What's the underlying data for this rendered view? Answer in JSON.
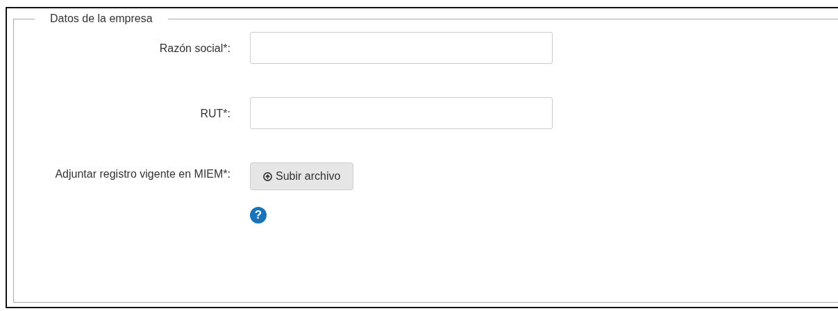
{
  "section": {
    "title": "Datos de la empresa"
  },
  "fields": [
    {
      "kind": "text",
      "label": "Razón social*:"
    },
    {
      "kind": "text",
      "label": "RUT*:"
    },
    {
      "kind": "file",
      "label": "Adjuntar registro vigente en MIEM*:",
      "button": "Subir archivo",
      "help": "?"
    }
  ]
}
